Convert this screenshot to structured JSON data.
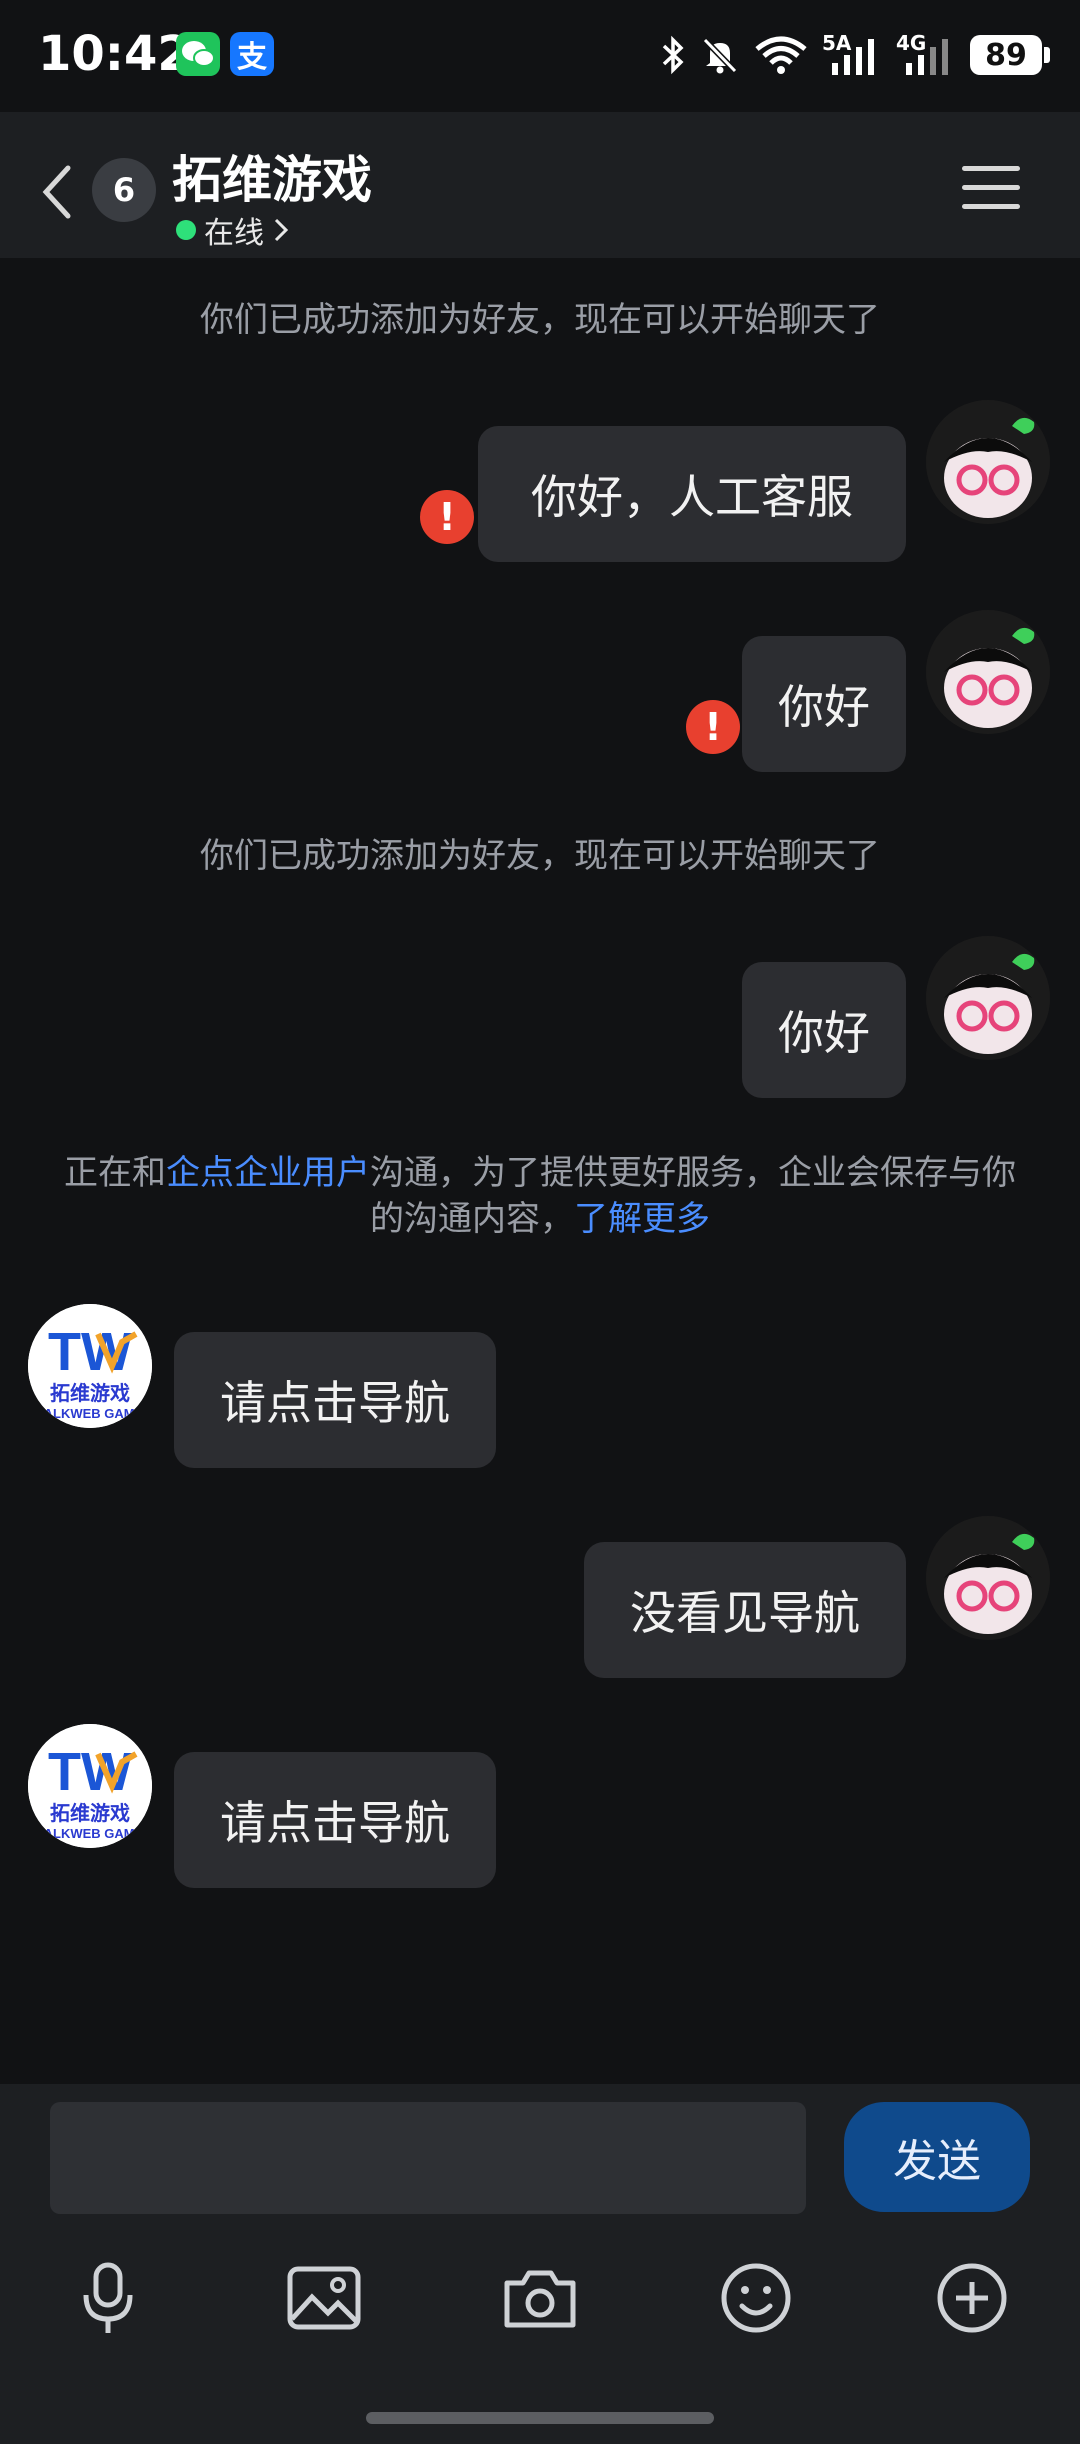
{
  "status_bar": {
    "time": "10:42",
    "net1": "5A",
    "net2": "4G",
    "battery": "89",
    "icons": [
      "wechat-icon",
      "alipay-icon",
      "bluetooth-icon",
      "mute-icon",
      "wifi-icon",
      "signal-icon",
      "signal-icon",
      "battery-icon"
    ]
  },
  "header": {
    "unread_count": "6",
    "title": "拓维游戏",
    "status": "在线"
  },
  "messages": {
    "sys1": "你们已成功添加为好友，现在可以开始聊天了",
    "m1": "你好，人工客服",
    "m2": "你好",
    "sys2": "你们已成功添加为好友，现在可以开始聊天了",
    "m3": "你好",
    "notice_pre": "正在和",
    "notice_link1": "企点企业用户",
    "notice_mid": "沟通，为了提供更好服务，企业会保存与你的沟通内容，",
    "notice_link2": "了解更多",
    "r1": "请点击导航",
    "m4": "没看见导航",
    "r2": "请点击导航"
  },
  "biz_avatar": {
    "logo_text": "TW",
    "cn_text": "拓维游戏",
    "en_text": "TALKWEB GAME"
  },
  "input": {
    "value": "",
    "send_label": "发送"
  },
  "toolbar": [
    "microphone-icon",
    "image-icon",
    "camera-icon",
    "emoji-icon",
    "plus-icon"
  ],
  "colors": {
    "background": "#111214",
    "bubble": "#2c2d31",
    "link": "#4a8dff",
    "send": "#0f4a8c",
    "error": "#e8402f",
    "online": "#2ee07a"
  }
}
